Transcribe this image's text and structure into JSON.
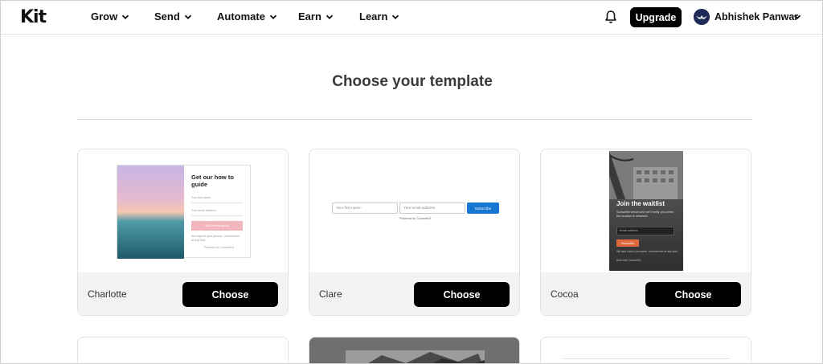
{
  "header": {
    "logo": "Kit",
    "nav": [
      {
        "label": "Grow"
      },
      {
        "label": "Send"
      },
      {
        "label": "Automate"
      },
      {
        "label": "Earn"
      },
      {
        "label": "Learn"
      }
    ],
    "upgrade_label": "Upgrade",
    "user_name": "Abhishek Panwar"
  },
  "main": {
    "title": "Choose your template",
    "templates": [
      {
        "name": "Charlotte",
        "choose_label": "Choose",
        "preview": {
          "heading": "Get our how to guide",
          "field1": "Your first name",
          "field2": "Your email address",
          "button": "Send me the guide",
          "disclaimer": "We respect your privacy. Unsubscribe at any time.",
          "powered": "Powered by ConvertKit"
        }
      },
      {
        "name": "Clare",
        "choose_label": "Choose",
        "preview": {
          "field1": "Your first name",
          "field2": "Your email address",
          "button": "Subscribe",
          "powered": "Powered by ConvertKit"
        }
      },
      {
        "name": "Cocoa",
        "choose_label": "Choose",
        "preview": {
          "heading": "Join the waitlist",
          "subtext": "Subscribe below and we'll notify you when the product is released.",
          "field": "Email address",
          "button": "Subscribe",
          "disclaimer": "We won't send you spam. Unsubscribe at any time.",
          "powered": "Built with ConvertKit"
        }
      }
    ]
  },
  "colors": {
    "accent": "#000000",
    "clare_button": "#1677d2",
    "cocoa_button": "#e0683e",
    "charlotte_button": "#f2b7bd"
  }
}
